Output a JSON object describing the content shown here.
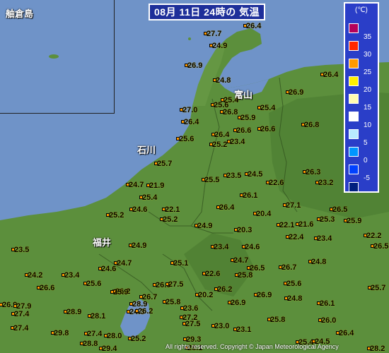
{
  "title": "08月 11日 24時の 気温",
  "inset_label": "舳倉島",
  "places": {
    "toyama": "富山",
    "ishikawa": "石川",
    "fukui": "福井"
  },
  "legend": {
    "unit": "(℃)",
    "items": [
      {
        "color": "#b4005a",
        "label": "35"
      },
      {
        "color": "#ff2800",
        "label": "30"
      },
      {
        "color": "#ff9900",
        "label": "25"
      },
      {
        "color": "#fff000",
        "label": "20"
      },
      {
        "color": "#fffbb0",
        "label": "15"
      },
      {
        "color": "#ffffff",
        "label": "10"
      },
      {
        "color": "#b9ebff",
        "label": "5"
      },
      {
        "color": "#0096ff",
        "label": "0"
      },
      {
        "color": "#0041ff",
        "label": "-5"
      },
      {
        "color": "#002080",
        "label": ""
      }
    ]
  },
  "readings": [
    "26.4",
    "27.7",
    "24.9",
    "26.9",
    "24.8",
    "26.4",
    "25.4",
    "27.0",
    "26.9",
    "25.6",
    "26.8",
    "25.9",
    "26.4",
    "26.6",
    "25.4",
    "26.4",
    "26.6",
    "25.2",
    "23.4",
    "26.8",
    "25.6",
    "25.7",
    "25.5",
    "23.5",
    "24.5",
    "26.3",
    "24.7",
    "21.9",
    "22.6",
    "23.2",
    "25.4",
    "26.1",
    "24.6",
    "22.1",
    "27.1",
    "26.5",
    "25.2",
    "26.4",
    "20.4",
    "25.2",
    "22.1",
    "21.6",
    "25.3",
    "25.9",
    "24.9",
    "20.3",
    "22.4",
    "23.4",
    "22.2",
    "23.5",
    "24.9",
    "23.4",
    "24.6",
    "26.5",
    "24.7",
    "24.6",
    "25.1",
    "24.7",
    "26.5",
    "26.7",
    "24.8",
    "24.2",
    "23.4",
    "22.6",
    "25.8",
    "25.6",
    "25.6",
    "26.2",
    "26.6",
    "27.5",
    "26.6",
    "26.2",
    "25.9",
    "26.7",
    "26.9",
    "25.7",
    "28.9",
    "25.8",
    "20.2",
    "24.8",
    "26.1",
    "26.9",
    "26.9",
    "27.9",
    "23.6",
    "24.3",
    "25.8",
    "27.4",
    "28.9",
    "28.0",
    "28.1",
    "26.2",
    "27.2",
    "26.0",
    "27.5",
    "27.4",
    "29.8",
    "27.4",
    "23.0",
    "23.1",
    "25.2",
    "26.4",
    "29.4",
    "28.8",
    "29.3",
    "25.4",
    "24.5",
    "28.2",
    "28.1"
  ],
  "copyright": "All rights reserved. Copyright © Japan Meteorological Agency"
}
